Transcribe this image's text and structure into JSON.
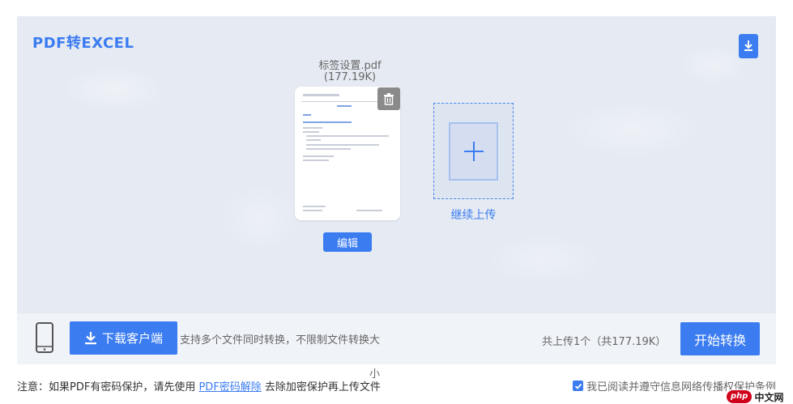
{
  "panel": {
    "title": "PDF转EXCEL"
  },
  "file": {
    "name": "标签设置.pdf",
    "size": "(177.19K)",
    "edit_label": "编辑"
  },
  "upload": {
    "continue_label": "继续上传"
  },
  "bottom": {
    "client_button": "下载客户端",
    "support_text": "支持多个文件同时转换，不限制文件转换大",
    "support_tail": "小",
    "count_text": "共上传1个（共177.19K）",
    "start_button": "开始转换"
  },
  "notice": {
    "prefix": "注意：如果PDF有密码保护，请先使用 ",
    "link": "PDF密码解除",
    "suffix": " 去除加密保护再上传文件"
  },
  "agreement": {
    "label": "我已阅读并遵守信息网络传播权保护条例",
    "checked": true
  },
  "watermark": {
    "php": "php",
    "cn": "中文网"
  },
  "colors": {
    "accent": "#3b7cf1",
    "panel_bg": "#e6ebf3",
    "bar_bg": "#f0f3f8"
  }
}
